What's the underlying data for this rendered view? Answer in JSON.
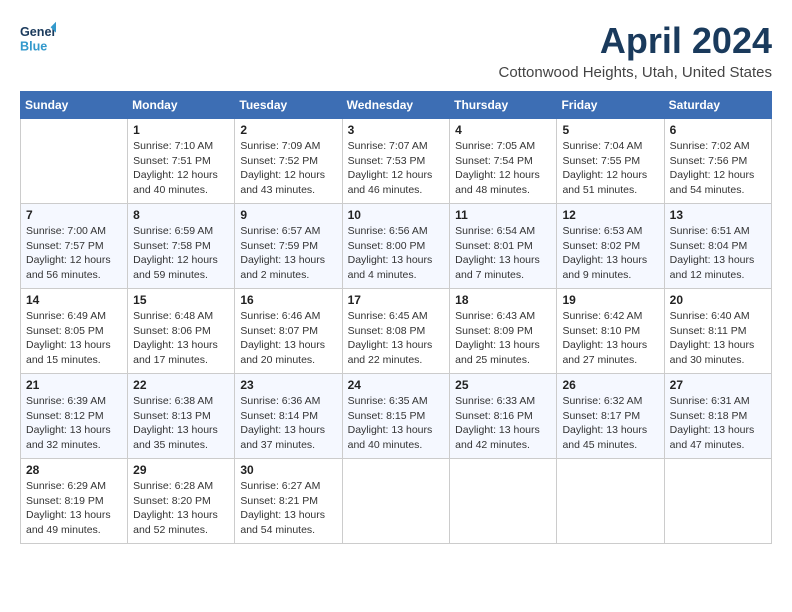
{
  "header": {
    "logo_line1": "General",
    "logo_line2": "Blue",
    "month": "April 2024",
    "location": "Cottonwood Heights, Utah, United States"
  },
  "columns": [
    "Sunday",
    "Monday",
    "Tuesday",
    "Wednesday",
    "Thursday",
    "Friday",
    "Saturday"
  ],
  "weeks": [
    [
      {
        "day": "",
        "sunrise": "",
        "sunset": "",
        "daylight": ""
      },
      {
        "day": "1",
        "sunrise": "Sunrise: 7:10 AM",
        "sunset": "Sunset: 7:51 PM",
        "daylight": "Daylight: 12 hours and 40 minutes."
      },
      {
        "day": "2",
        "sunrise": "Sunrise: 7:09 AM",
        "sunset": "Sunset: 7:52 PM",
        "daylight": "Daylight: 12 hours and 43 minutes."
      },
      {
        "day": "3",
        "sunrise": "Sunrise: 7:07 AM",
        "sunset": "Sunset: 7:53 PM",
        "daylight": "Daylight: 12 hours and 46 minutes."
      },
      {
        "day": "4",
        "sunrise": "Sunrise: 7:05 AM",
        "sunset": "Sunset: 7:54 PM",
        "daylight": "Daylight: 12 hours and 48 minutes."
      },
      {
        "day": "5",
        "sunrise": "Sunrise: 7:04 AM",
        "sunset": "Sunset: 7:55 PM",
        "daylight": "Daylight: 12 hours and 51 minutes."
      },
      {
        "day": "6",
        "sunrise": "Sunrise: 7:02 AM",
        "sunset": "Sunset: 7:56 PM",
        "daylight": "Daylight: 12 hours and 54 minutes."
      }
    ],
    [
      {
        "day": "7",
        "sunrise": "Sunrise: 7:00 AM",
        "sunset": "Sunset: 7:57 PM",
        "daylight": "Daylight: 12 hours and 56 minutes."
      },
      {
        "day": "8",
        "sunrise": "Sunrise: 6:59 AM",
        "sunset": "Sunset: 7:58 PM",
        "daylight": "Daylight: 12 hours and 59 minutes."
      },
      {
        "day": "9",
        "sunrise": "Sunrise: 6:57 AM",
        "sunset": "Sunset: 7:59 PM",
        "daylight": "Daylight: 13 hours and 2 minutes."
      },
      {
        "day": "10",
        "sunrise": "Sunrise: 6:56 AM",
        "sunset": "Sunset: 8:00 PM",
        "daylight": "Daylight: 13 hours and 4 minutes."
      },
      {
        "day": "11",
        "sunrise": "Sunrise: 6:54 AM",
        "sunset": "Sunset: 8:01 PM",
        "daylight": "Daylight: 13 hours and 7 minutes."
      },
      {
        "day": "12",
        "sunrise": "Sunrise: 6:53 AM",
        "sunset": "Sunset: 8:02 PM",
        "daylight": "Daylight: 13 hours and 9 minutes."
      },
      {
        "day": "13",
        "sunrise": "Sunrise: 6:51 AM",
        "sunset": "Sunset: 8:04 PM",
        "daylight": "Daylight: 13 hours and 12 minutes."
      }
    ],
    [
      {
        "day": "14",
        "sunrise": "Sunrise: 6:49 AM",
        "sunset": "Sunset: 8:05 PM",
        "daylight": "Daylight: 13 hours and 15 minutes."
      },
      {
        "day": "15",
        "sunrise": "Sunrise: 6:48 AM",
        "sunset": "Sunset: 8:06 PM",
        "daylight": "Daylight: 13 hours and 17 minutes."
      },
      {
        "day": "16",
        "sunrise": "Sunrise: 6:46 AM",
        "sunset": "Sunset: 8:07 PM",
        "daylight": "Daylight: 13 hours and 20 minutes."
      },
      {
        "day": "17",
        "sunrise": "Sunrise: 6:45 AM",
        "sunset": "Sunset: 8:08 PM",
        "daylight": "Daylight: 13 hours and 22 minutes."
      },
      {
        "day": "18",
        "sunrise": "Sunrise: 6:43 AM",
        "sunset": "Sunset: 8:09 PM",
        "daylight": "Daylight: 13 hours and 25 minutes."
      },
      {
        "day": "19",
        "sunrise": "Sunrise: 6:42 AM",
        "sunset": "Sunset: 8:10 PM",
        "daylight": "Daylight: 13 hours and 27 minutes."
      },
      {
        "day": "20",
        "sunrise": "Sunrise: 6:40 AM",
        "sunset": "Sunset: 8:11 PM",
        "daylight": "Daylight: 13 hours and 30 minutes."
      }
    ],
    [
      {
        "day": "21",
        "sunrise": "Sunrise: 6:39 AM",
        "sunset": "Sunset: 8:12 PM",
        "daylight": "Daylight: 13 hours and 32 minutes."
      },
      {
        "day": "22",
        "sunrise": "Sunrise: 6:38 AM",
        "sunset": "Sunset: 8:13 PM",
        "daylight": "Daylight: 13 hours and 35 minutes."
      },
      {
        "day": "23",
        "sunrise": "Sunrise: 6:36 AM",
        "sunset": "Sunset: 8:14 PM",
        "daylight": "Daylight: 13 hours and 37 minutes."
      },
      {
        "day": "24",
        "sunrise": "Sunrise: 6:35 AM",
        "sunset": "Sunset: 8:15 PM",
        "daylight": "Daylight: 13 hours and 40 minutes."
      },
      {
        "day": "25",
        "sunrise": "Sunrise: 6:33 AM",
        "sunset": "Sunset: 8:16 PM",
        "daylight": "Daylight: 13 hours and 42 minutes."
      },
      {
        "day": "26",
        "sunrise": "Sunrise: 6:32 AM",
        "sunset": "Sunset: 8:17 PM",
        "daylight": "Daylight: 13 hours and 45 minutes."
      },
      {
        "day": "27",
        "sunrise": "Sunrise: 6:31 AM",
        "sunset": "Sunset: 8:18 PM",
        "daylight": "Daylight: 13 hours and 47 minutes."
      }
    ],
    [
      {
        "day": "28",
        "sunrise": "Sunrise: 6:29 AM",
        "sunset": "Sunset: 8:19 PM",
        "daylight": "Daylight: 13 hours and 49 minutes."
      },
      {
        "day": "29",
        "sunrise": "Sunrise: 6:28 AM",
        "sunset": "Sunset: 8:20 PM",
        "daylight": "Daylight: 13 hours and 52 minutes."
      },
      {
        "day": "30",
        "sunrise": "Sunrise: 6:27 AM",
        "sunset": "Sunset: 8:21 PM",
        "daylight": "Daylight: 13 hours and 54 minutes."
      },
      {
        "day": "",
        "sunrise": "",
        "sunset": "",
        "daylight": ""
      },
      {
        "day": "",
        "sunrise": "",
        "sunset": "",
        "daylight": ""
      },
      {
        "day": "",
        "sunrise": "",
        "sunset": "",
        "daylight": ""
      },
      {
        "day": "",
        "sunrise": "",
        "sunset": "",
        "daylight": ""
      }
    ]
  ]
}
